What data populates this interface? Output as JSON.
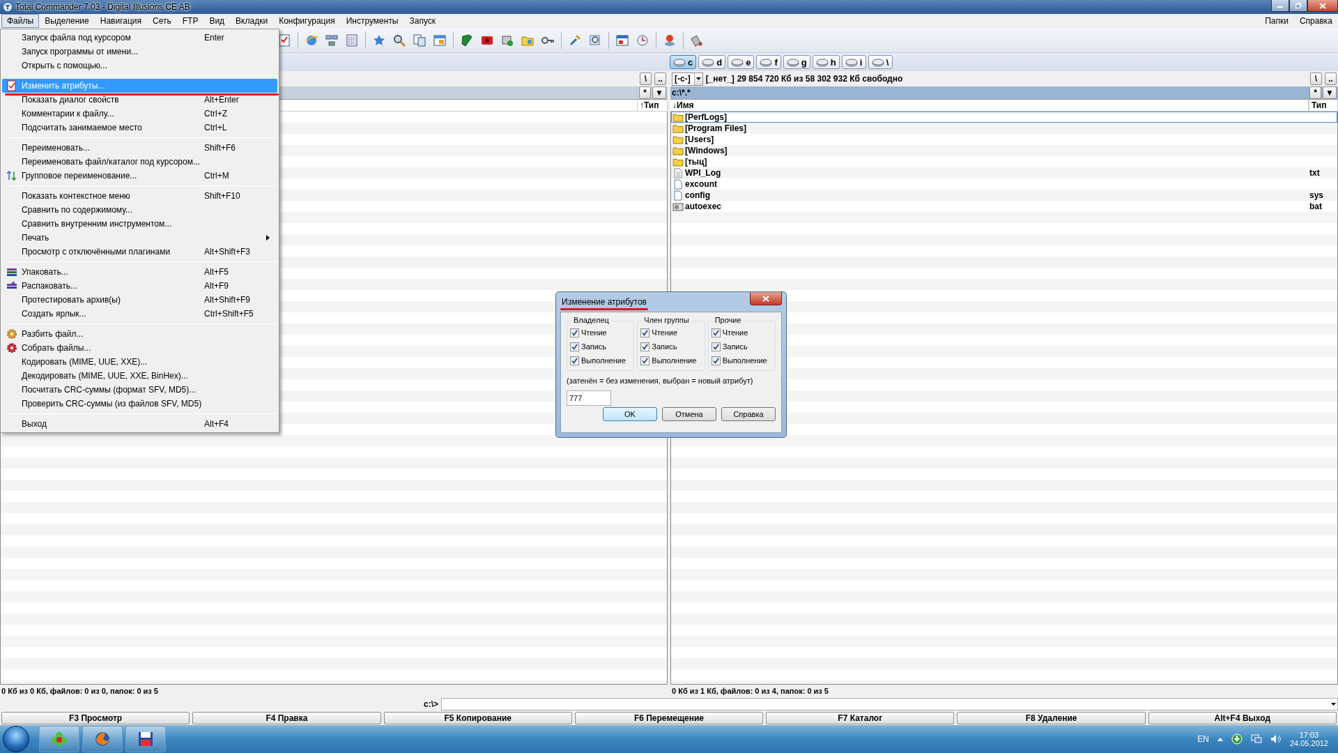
{
  "window": {
    "title": "Total Commander 7.03 - Digital Illusions CE AB"
  },
  "menubar": {
    "items": [
      {
        "label": "Файлы",
        "selected": true
      },
      {
        "label": "Выделение",
        "selected": false
      },
      {
        "label": "Навигация",
        "selected": false
      },
      {
        "label": "Сеть",
        "selected": false
      },
      {
        "label": "FTP",
        "selected": false
      },
      {
        "label": "Вид",
        "selected": false
      },
      {
        "label": "Вкладки",
        "selected": false
      },
      {
        "label": "Конфигурация",
        "selected": false
      },
      {
        "label": "Инструменты",
        "selected": false
      },
      {
        "label": "Запуск",
        "selected": false
      }
    ],
    "right_items": [
      {
        "label": "Папки",
        "selected": false
      },
      {
        "label": "Справка",
        "selected": false
      }
    ]
  },
  "drives": [
    {
      "letter": "c",
      "selected": true
    },
    {
      "letter": "d",
      "selected": false
    },
    {
      "letter": "e",
      "selected": false
    },
    {
      "letter": "f",
      "selected": false
    },
    {
      "letter": "g",
      "selected": false
    },
    {
      "letter": "h",
      "selected": false
    },
    {
      "letter": "i",
      "selected": false
    },
    {
      "letter": "\\",
      "selected": false
    }
  ],
  "left_panel": {
    "nav_buttons": [
      "\\",
      ".."
    ],
    "filter_buttons": [
      "*",
      "▼"
    ],
    "columns": [
      "↑Тип"
    ],
    "status": "0 Кб из 0 Кб, файлов: 0 из 0, папок: 0 из 5"
  },
  "right_panel": {
    "drive_combo": "[-c-]",
    "volume_label": "[_нет_]",
    "free_space": "29 854 720 Кб из 58 302 932 Кб свободно",
    "nav_buttons": [
      "\\",
      ".."
    ],
    "path": "c:\\*.*",
    "filter_buttons": [
      "*",
      "▼"
    ],
    "columns": [
      "↓Имя",
      "Тип"
    ],
    "files": [
      {
        "name": "[PerfLogs]",
        "kind": "folder",
        "focused": true
      },
      {
        "name": "[Program Files]",
        "kind": "folder",
        "focused": false
      },
      {
        "name": "[Users]",
        "kind": "folder",
        "focused": false
      },
      {
        "name": "[Windows]",
        "kind": "folder",
        "focused": false
      },
      {
        "name": "[тыц]",
        "kind": "folder",
        "focused": false
      },
      {
        "name": "WPI_Log",
        "type": "txt",
        "kind": "text",
        "focused": false
      },
      {
        "name": "excount",
        "kind": "file",
        "focused": false
      },
      {
        "name": "config",
        "type": "sys",
        "kind": "file",
        "focused": false
      },
      {
        "name": "autoexec",
        "type": "bat",
        "kind": "batch",
        "focused": false
      }
    ],
    "status": "0 Кб из 1 Кб, файлов: 0 из 4, папок: 0 из 5"
  },
  "command_line": {
    "prompt": "c:\\>"
  },
  "function_keys": [
    "F3 Просмотр",
    "F4 Правка",
    "F5 Копирование",
    "F6 Перемещение",
    "F7 Каталог",
    "F8 Удаление",
    "Alt+F4 Выход"
  ],
  "files_menu": {
    "items": [
      {
        "kind": "item",
        "label": "Запуск файла под курсором",
        "shortcut": "Enter",
        "selected": false
      },
      {
        "kind": "item",
        "label": "Запуск программы от имени...",
        "selected": false
      },
      {
        "kind": "item",
        "label": "Открыть с помощью...",
        "selected": false
      },
      {
        "kind": "separator"
      },
      {
        "kind": "item",
        "label": "Изменить атрибуты...",
        "selected": true
      },
      {
        "kind": "item",
        "label": "Показать диалог свойств",
        "shortcut": "Alt+Enter",
        "selected": false
      },
      {
        "kind": "item",
        "label": "Комментарии к файлу...",
        "shortcut": "Ctrl+Z",
        "selected": false
      },
      {
        "kind": "item",
        "label": "Подсчитать занимаемое место",
        "shortcut": "Ctrl+L",
        "selected": false
      },
      {
        "kind": "separator"
      },
      {
        "kind": "item",
        "label": "Переименовать...",
        "shortcut": "Shift+F6",
        "selected": false
      },
      {
        "kind": "item",
        "label": "Переименовать файл/каталог под курсором...",
        "selected": false
      },
      {
        "kind": "item",
        "label": "Групповое переименование...",
        "shortcut": "Ctrl+M",
        "selected": false
      },
      {
        "kind": "separator"
      },
      {
        "kind": "item",
        "label": "Показать контекстное меню",
        "shortcut": "Shift+F10",
        "selected": false
      },
      {
        "kind": "item",
        "label": "Сравнить по содержимому...",
        "selected": false
      },
      {
        "kind": "item",
        "label": "Сравнить внутренним инструментом...",
        "selected": false
      },
      {
        "kind": "submenu",
        "label": "Печать",
        "selected": false
      },
      {
        "kind": "item",
        "label": "Просмотр с отключёнными плагинами",
        "shortcut": "Alt+Shift+F3",
        "selected": false
      },
      {
        "kind": "separator"
      },
      {
        "kind": "item",
        "label": "Упаковать...",
        "shortcut": "Alt+F5",
        "selected": false
      },
      {
        "kind": "item",
        "label": "Распаковать...",
        "shortcut": "Alt+F9",
        "selected": false
      },
      {
        "kind": "item",
        "label": "Протестировать архив(ы)",
        "shortcut": "Alt+Shift+F9",
        "selected": false
      },
      {
        "kind": "item",
        "label": "Создать ярлык...",
        "shortcut": "Ctrl+Shift+F5",
        "selected": false
      },
      {
        "kind": "separator"
      },
      {
        "kind": "item",
        "label": "Разбить файл...",
        "selected": false
      },
      {
        "kind": "item",
        "label": "Собрать файлы...",
        "selected": false
      },
      {
        "kind": "item",
        "label": "Кодировать (MIME, UUE, XXE)...",
        "selected": false
      },
      {
        "kind": "item",
        "label": "Декодировать (MIME, UUE, XXE, BinHex)...",
        "selected": false
      },
      {
        "kind": "item",
        "label": "Посчитать CRC-суммы (формат SFV, MD5)...",
        "selected": false
      },
      {
        "kind": "item",
        "label": "Проверить CRC-суммы (из файлов SFV, MD5)",
        "selected": false
      },
      {
        "kind": "separator"
      },
      {
        "kind": "item",
        "label": "Выход",
        "shortcut": "Alt+F4",
        "selected": false
      }
    ]
  },
  "dialog": {
    "title": "Изменение атрибутов",
    "groups": [
      {
        "label": "Владелец",
        "options": [
          {
            "label": "Чтение",
            "checked": true
          },
          {
            "label": "Запись",
            "checked": true
          },
          {
            "label": "Выполнение",
            "checked": true
          }
        ]
      },
      {
        "label": "Член группы",
        "options": [
          {
            "label": "Чтение",
            "checked": true
          },
          {
            "label": "Запись",
            "checked": true
          },
          {
            "label": "Выполнение",
            "checked": true
          }
        ]
      },
      {
        "label": "Прочие",
        "options": [
          {
            "label": "Чтение",
            "checked": true
          },
          {
            "label": "Запись",
            "checked": true
          },
          {
            "label": "Выполнение",
            "checked": true
          }
        ]
      }
    ],
    "hint": "(затенён = без изменения, выбран = новый атрибут)",
    "value": "777",
    "buttons": [
      {
        "label": "OK",
        "default": true
      },
      {
        "label": "Отмена",
        "default": false
      },
      {
        "label": "Справка",
        "default": false
      }
    ]
  },
  "taskbar": {
    "language": "EN",
    "time": "17:03",
    "date": "24.05.2012"
  }
}
